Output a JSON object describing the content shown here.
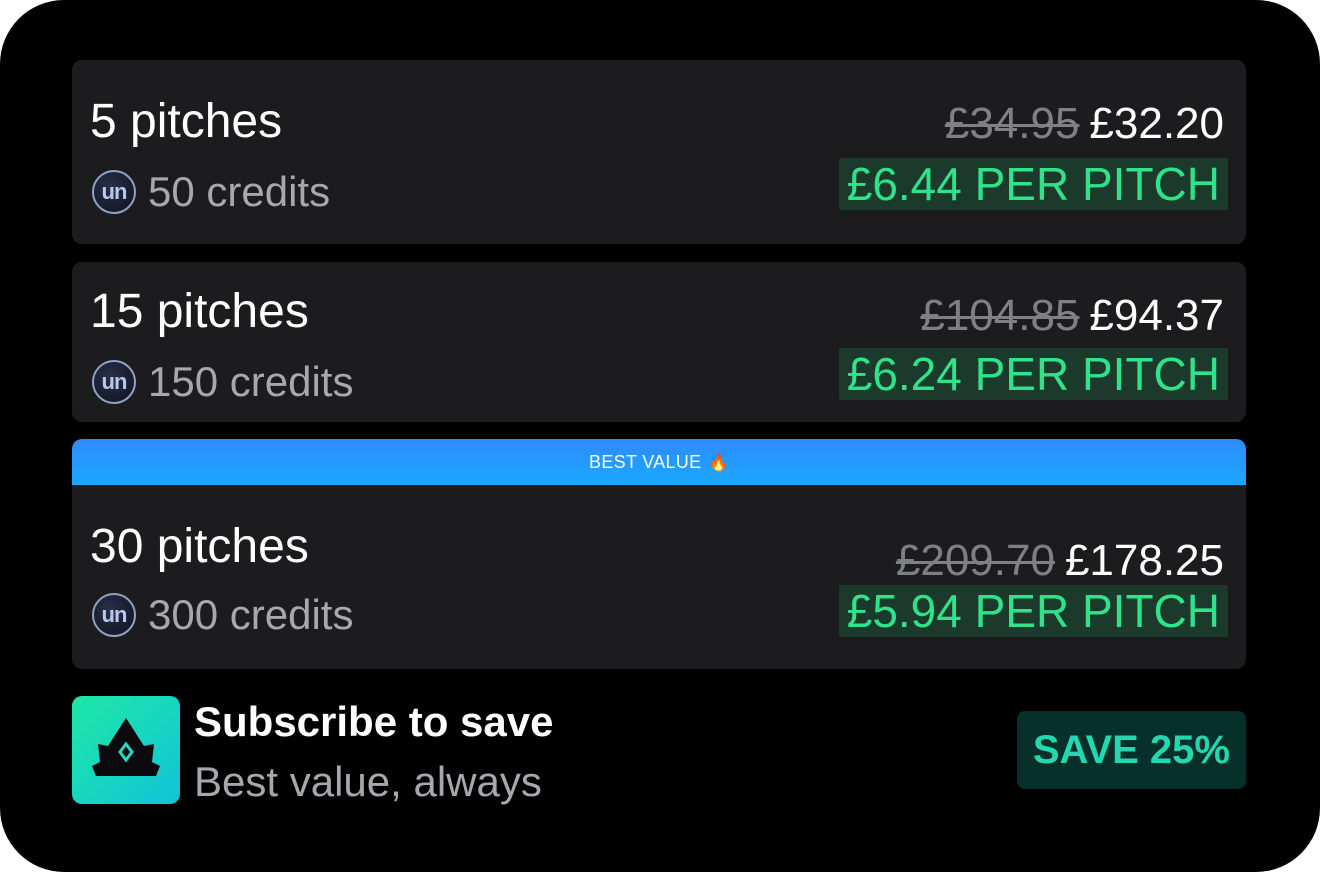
{
  "brand": {
    "coin_label": "un",
    "accent_green": "#2fe38a",
    "banner_blue": "#1aa8ff"
  },
  "packages": [
    {
      "title": "5 pitches",
      "credits": "50 credits",
      "old_price": "£34.95",
      "new_price": "£32.20",
      "per_pitch": "£6.44 PER PITCH"
    },
    {
      "title": "15 pitches",
      "credits": "150 credits",
      "old_price": "£104.85",
      "new_price": "£94.37",
      "per_pitch": "£6.24 PER PITCH"
    },
    {
      "badge": "BEST VALUE",
      "badge_emoji": "🔥",
      "title": "30 pitches",
      "credits": "300 credits",
      "old_price": "£209.70",
      "new_price": "£178.25",
      "per_pitch": "£5.94 PER PITCH"
    }
  ],
  "subscribe": {
    "icon": "crown-icon",
    "title": "Subscribe to save",
    "subtitle": "Best value, always",
    "badge": "SAVE 25%"
  }
}
